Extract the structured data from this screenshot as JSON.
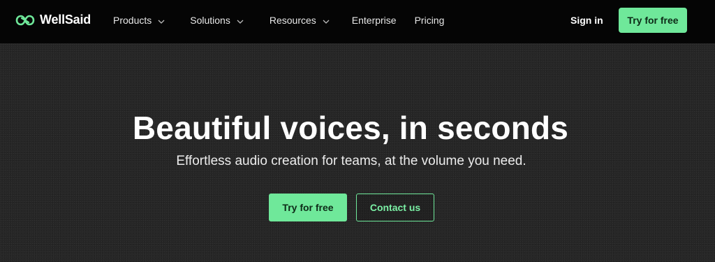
{
  "brand": {
    "name": "WellSaid",
    "logo_icon": "double-loop-infinity-icon",
    "accent_color": "#6fe89a"
  },
  "nav": {
    "items": [
      {
        "label": "Products",
        "has_dropdown": true
      },
      {
        "label": "Solutions",
        "has_dropdown": true
      },
      {
        "label": "Resources",
        "has_dropdown": true
      },
      {
        "label": "Enterprise",
        "has_dropdown": false
      },
      {
        "label": "Pricing",
        "has_dropdown": false
      }
    ],
    "sign_in_label": "Sign in",
    "cta_label": "Try for free"
  },
  "hero": {
    "title": "Beautiful voices, in seconds",
    "subtitle": "Effortless audio creation for teams, at the volume you need.",
    "primary_button_label": "Try for free",
    "secondary_button_label": "Contact us"
  }
}
